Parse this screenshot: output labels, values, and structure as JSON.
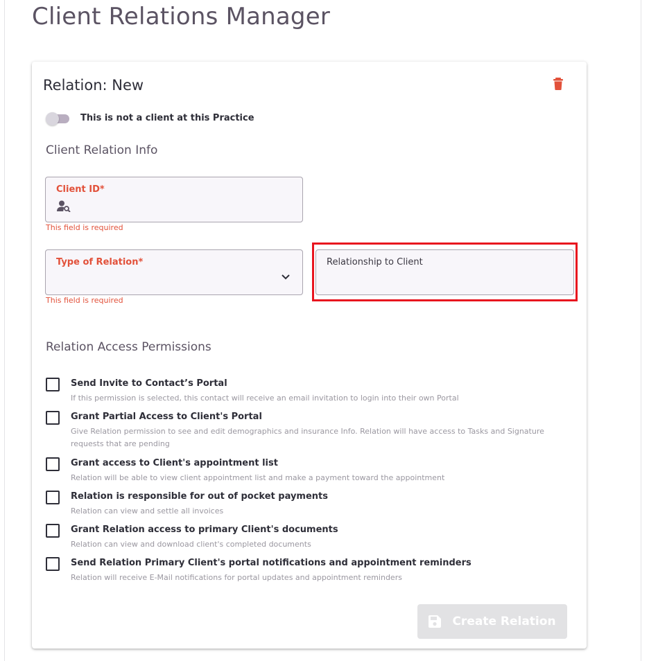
{
  "page": {
    "title": "Client Relations Manager"
  },
  "card": {
    "title": "Relation: New",
    "delete_icon": "trash-icon"
  },
  "toggle": {
    "label": "This is not a client at this Practice",
    "checked": false
  },
  "info_section": {
    "heading": "Client Relation Info"
  },
  "client_id": {
    "label": "Client ID*",
    "value": "",
    "icon": "user-search-icon",
    "error": "This field is required"
  },
  "type_of_relation": {
    "label": "Type of Relation*",
    "value": "",
    "error": "This field is required"
  },
  "relationship_to_client": {
    "label": "Relationship to Client",
    "value": ""
  },
  "permissions_section": {
    "heading": "Relation Access Permissions"
  },
  "permissions": [
    {
      "title": "Send Invite to Contact’s Portal",
      "description": "If this permission is selected, this contact will receive an email invitation to login into their own Portal",
      "checked": false
    },
    {
      "title": "Grant Partial Access to Client's Portal",
      "description": "Give Relation permission to see and edit demographics and insurance Info. Relation will have access to Tasks and Signature requests that are pending",
      "checked": false
    },
    {
      "title": "Grant access to Client's appointment list",
      "description": "Relation will be able to view client appointment list and make a payment toward the appointment",
      "checked": false
    },
    {
      "title": "Relation is responsible for out of pocket payments",
      "description": "Relation can view and settle all invoices",
      "checked": false
    },
    {
      "title": "Grant Relation access to primary Client's documents",
      "description": "Relation can view and download client's completed documents",
      "checked": false
    },
    {
      "title": "Send Relation Primary Client's portal notifications and appointment reminders",
      "description": "Relation will receive E-Mail notifications for portal updates and appointment reminders",
      "checked": false
    }
  ],
  "actions": {
    "create_label": "Create Relation",
    "create_icon": "save-icon",
    "create_disabled": true
  },
  "colors": {
    "accent_error": "#e2513a",
    "highlight": "#e8141e",
    "title_purple": "#5b5363"
  }
}
